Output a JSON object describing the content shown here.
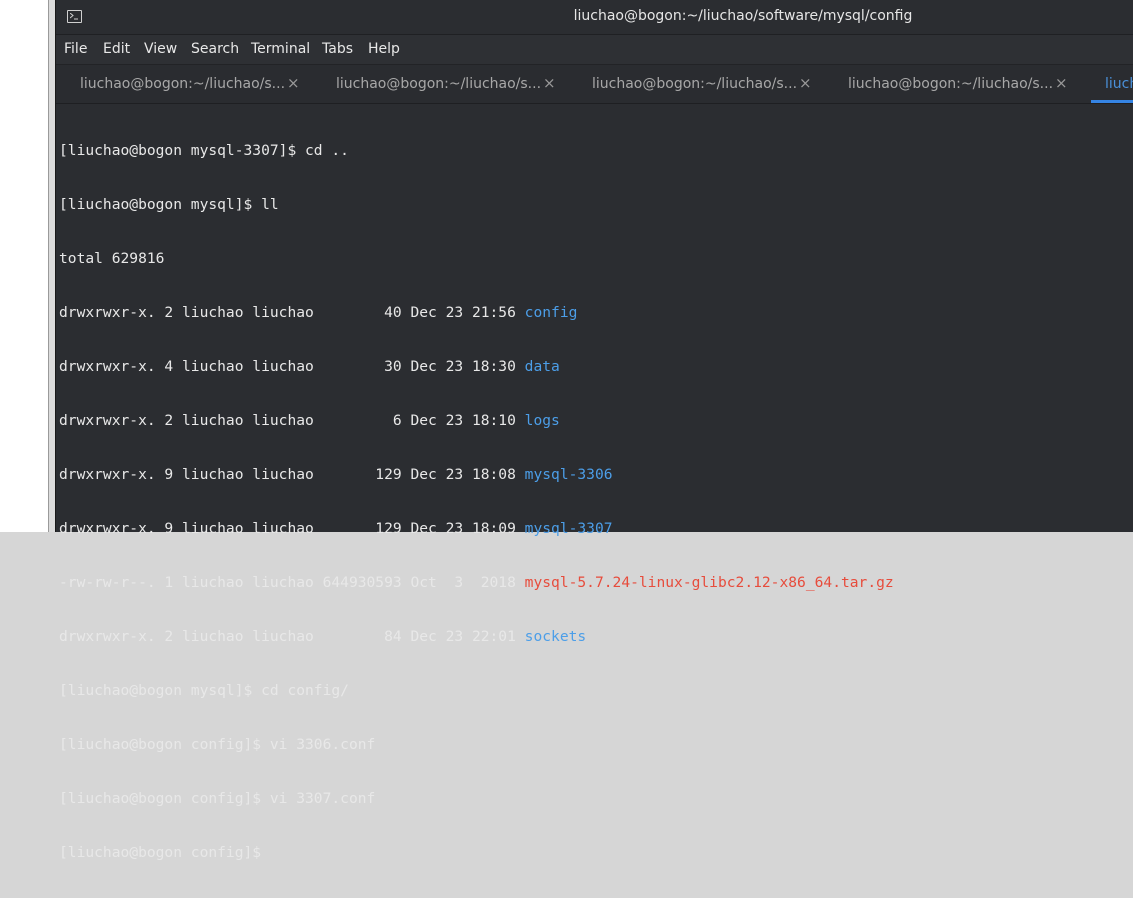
{
  "window": {
    "title": "liuchao@bogon:~/liuchao/software/mysql/config"
  },
  "menu": [
    "File",
    "Edit",
    "View",
    "Search",
    "Terminal",
    "Tabs",
    "Help"
  ],
  "tabs": [
    {
      "label": "liuchao@bogon:~/liuchao/s...",
      "close": "×"
    },
    {
      "label": "liuchao@bogon:~/liuchao/s...",
      "close": "×"
    },
    {
      "label": "liuchao@bogon:~/liuchao/s...",
      "close": "×"
    },
    {
      "label": "liuchao@bogon:~/liuchao/s...",
      "close": "×"
    },
    {
      "label": "liuch",
      "active": true
    }
  ],
  "terminal": {
    "lines": [
      {
        "text": "[liuchao@bogon mysql-3307]$ cd .."
      },
      {
        "text": "[liuchao@bogon mysql]$ ll"
      },
      {
        "text": "total 629816"
      },
      {
        "prefix": "drwxrwxr-x. 2 liuchao liuchao        40 Dec 23 21:56 ",
        "name": "config",
        "color": "#4c9ee8"
      },
      {
        "prefix": "drwxrwxr-x. 4 liuchao liuchao        30 Dec 23 18:30 ",
        "name": "data",
        "color": "#4c9ee8"
      },
      {
        "prefix": "drwxrwxr-x. 2 liuchao liuchao         6 Dec 23 18:10 ",
        "name": "logs",
        "color": "#4c9ee8"
      },
      {
        "prefix": "drwxrwxr-x. 9 liuchao liuchao       129 Dec 23 18:08 ",
        "name": "mysql-3306",
        "color": "#4c9ee8"
      },
      {
        "prefix": "drwxrwxr-x. 9 liuchao liuchao       129 Dec 23 18:09 ",
        "name": "mysql-3307",
        "color": "#4c9ee8"
      },
      {
        "prefix": "-rw-rw-r--. 1 liuchao liuchao 644930593 Oct  3  2018 ",
        "name": "mysql-5.7.24-linux-glibc2.12-x86_64.tar.gz",
        "color": "#e74c3c"
      },
      {
        "prefix": "drwxrwxr-x. 2 liuchao liuchao        84 Dec 23 22:01 ",
        "name": "sockets",
        "color": "#4c9ee8"
      },
      {
        "text": "[liuchao@bogon mysql]$ cd config/"
      },
      {
        "text": "[liuchao@bogon config]$ vi 3306.conf"
      },
      {
        "text": "[liuchao@bogon config]$ vi 3307.conf"
      },
      {
        "text": "[liuchao@bogon config]$ "
      }
    ]
  },
  "colors": {
    "background": "#2b2d31",
    "foreground": "#e8e8e8",
    "directory": "#4c9ee8",
    "archive": "#e74c3c",
    "active_tab_accent": "#3584e4"
  }
}
